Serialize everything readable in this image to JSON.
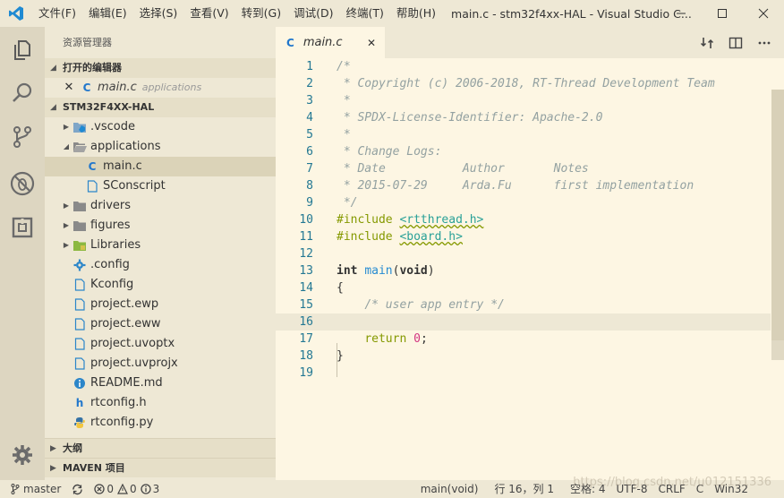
{
  "titlebar": {
    "menu": [
      "文件(F)",
      "编辑(E)",
      "选择(S)",
      "查看(V)",
      "转到(G)",
      "调试(D)",
      "终端(T)",
      "帮助(H)"
    ],
    "title": "main.c - stm32f4xx-HAL - Visual Studio C..."
  },
  "sidebar": {
    "header": "资源管理器",
    "open_editors_title": "打开的编辑器",
    "open_editors": [
      {
        "name": "main.c",
        "dir": "applications",
        "icon": "c-file-icon"
      }
    ],
    "project_title": "STM32F4XX-HAL",
    "tree": [
      {
        "label": ".vscode",
        "type": "folder",
        "twisty": "collapsed",
        "depth": 0
      },
      {
        "label": "applications",
        "type": "folder",
        "twisty": "expanded",
        "depth": 0
      },
      {
        "label": "main.c",
        "type": "c",
        "depth": 1,
        "selected": true
      },
      {
        "label": "SConscript",
        "type": "file",
        "depth": 1
      },
      {
        "label": "drivers",
        "type": "folder",
        "twisty": "collapsed",
        "depth": 0
      },
      {
        "label": "figures",
        "type": "folder",
        "twisty": "collapsed",
        "depth": 0
      },
      {
        "label": "Libraries",
        "type": "folder",
        "twisty": "collapsed",
        "depth": 0
      },
      {
        "label": ".config",
        "type": "gear",
        "depth": 0
      },
      {
        "label": "Kconfig",
        "type": "file",
        "depth": 0
      },
      {
        "label": "project.ewp",
        "type": "file",
        "depth": 0
      },
      {
        "label": "project.eww",
        "type": "file",
        "depth": 0
      },
      {
        "label": "project.uvoptx",
        "type": "file",
        "depth": 0
      },
      {
        "label": "project.uvprojx",
        "type": "file",
        "depth": 0
      },
      {
        "label": "README.md",
        "type": "info",
        "depth": 0
      },
      {
        "label": "rtconfig.h",
        "type": "h",
        "depth": 0
      },
      {
        "label": "rtconfig.py",
        "type": "py",
        "depth": 0
      }
    ],
    "outline_title": "大纲",
    "maven_title": "MAVEN 项目"
  },
  "editor": {
    "tab_label": "main.c",
    "lines": [
      {
        "n": "1",
        "parts": [
          [
            "cm",
            "/*"
          ]
        ]
      },
      {
        "n": "2",
        "parts": [
          [
            "cm",
            " * Copyright (c) 2006-2018, RT-Thread Development Team"
          ]
        ]
      },
      {
        "n": "3",
        "parts": [
          [
            "cm",
            " *"
          ]
        ]
      },
      {
        "n": "4",
        "parts": [
          [
            "cm",
            " * SPDX-License-Identifier: Apache-2.0"
          ]
        ]
      },
      {
        "n": "5",
        "parts": [
          [
            "cm",
            " *"
          ]
        ]
      },
      {
        "n": "6",
        "parts": [
          [
            "cm",
            " * Change Logs:"
          ]
        ]
      },
      {
        "n": "7",
        "parts": [
          [
            "cm",
            " * Date           Author       Notes"
          ]
        ]
      },
      {
        "n": "8",
        "parts": [
          [
            "cm",
            " * 2015-07-29     Arda.Fu      first implementation"
          ]
        ]
      },
      {
        "n": "9",
        "parts": [
          [
            "cm",
            " */"
          ]
        ]
      },
      {
        "n": "10",
        "parts": [
          [
            "pp",
            "#include "
          ],
          [
            "inc",
            "<rtthread.h>"
          ]
        ]
      },
      {
        "n": "11",
        "parts": [
          [
            "pp",
            "#include "
          ],
          [
            "inc",
            "<board.h>"
          ]
        ]
      },
      {
        "n": "12",
        "parts": []
      },
      {
        "n": "13",
        "parts": [
          [
            "kw",
            "int"
          ],
          [
            "plain",
            " "
          ],
          [
            "fn",
            "main"
          ],
          [
            "plain",
            "("
          ],
          [
            "kw",
            "void"
          ],
          [
            "plain",
            ")"
          ]
        ]
      },
      {
        "n": "14",
        "parts": [
          [
            "plain",
            "{"
          ]
        ]
      },
      {
        "n": "15",
        "parts": [
          [
            "plain",
            "    "
          ],
          [
            "cm",
            "/* user app entry */"
          ]
        ]
      },
      {
        "n": "16",
        "parts": [],
        "current": true
      },
      {
        "n": "17",
        "parts": [
          [
            "plain",
            "    "
          ],
          [
            "pp",
            "return"
          ],
          [
            "plain",
            " "
          ],
          [
            "num",
            "0"
          ],
          [
            "plain",
            ";"
          ]
        ]
      },
      {
        "n": "18",
        "parts": [
          [
            "plain",
            "}"
          ]
        ]
      },
      {
        "n": "19",
        "parts": []
      }
    ]
  },
  "statusbar": {
    "branch": "master",
    "errors": "0",
    "warnings": "0",
    "infos": "3",
    "function": "main(void)",
    "cursor": "行 16，列 1",
    "spaces": "空格: 4",
    "encoding": "UTF-8",
    "eol": "CRLF",
    "language": "C",
    "platform": "Win32"
  },
  "watermark": "https://blog.csdn.net/u012151336",
  "colors": {
    "accent": "#268bd2",
    "comment": "#93a1a1",
    "preprocessor": "#859900",
    "string": "#2aa198",
    "number": "#d33682",
    "background": "#fdf6e3",
    "sidebar": "#eee8d5"
  }
}
